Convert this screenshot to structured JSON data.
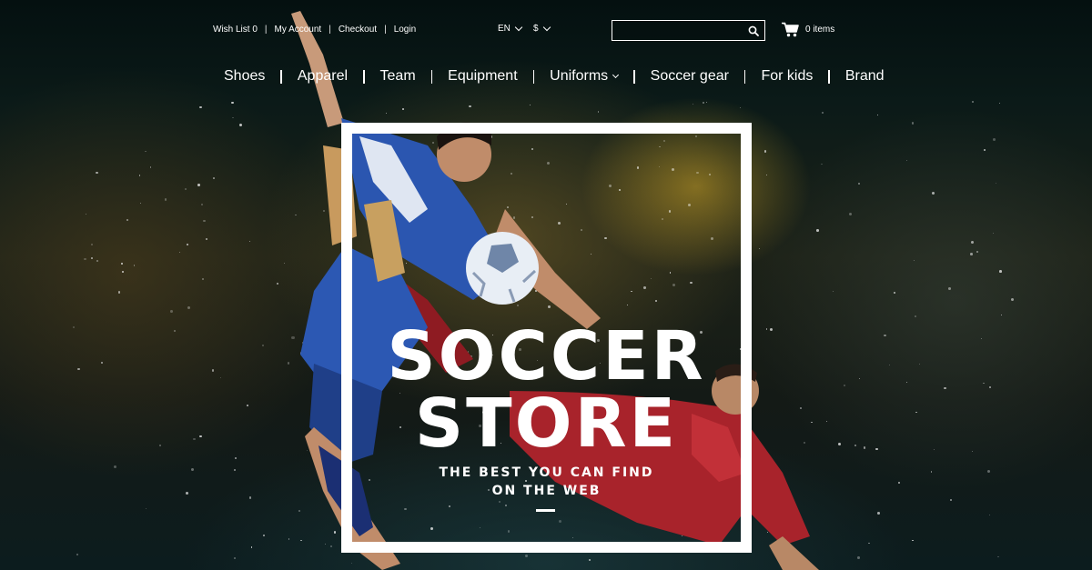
{
  "header": {
    "utility_links": [
      "Wish List 0",
      "My Account",
      "Checkout",
      "Login"
    ],
    "language": "EN",
    "currency": "$",
    "search": {
      "value": "",
      "placeholder": ""
    },
    "cart_label": "0 items"
  },
  "nav": {
    "items": [
      {
        "label": "Shoes"
      },
      {
        "label": "Apparel"
      },
      {
        "label": "Team"
      },
      {
        "label": "Equipment"
      },
      {
        "label": "Uniforms",
        "has_dropdown": true
      },
      {
        "label": "Soccer gear"
      },
      {
        "label": "For kids"
      },
      {
        "label": "Brand"
      }
    ]
  },
  "hero": {
    "title_line1": "SOCCER",
    "title_line2": "STORE",
    "subtitle_line1": "THE BEST YOU CAN FIND",
    "subtitle_line2": "ON THE WEB"
  },
  "colors": {
    "text": "#ffffff",
    "frame": "#ffffff",
    "background": "#0a1414",
    "jersey_blue": "#2b56b0",
    "jersey_red": "#b0232a"
  },
  "icons": [
    "search-icon",
    "cart-icon",
    "chevron-down-icon"
  ]
}
